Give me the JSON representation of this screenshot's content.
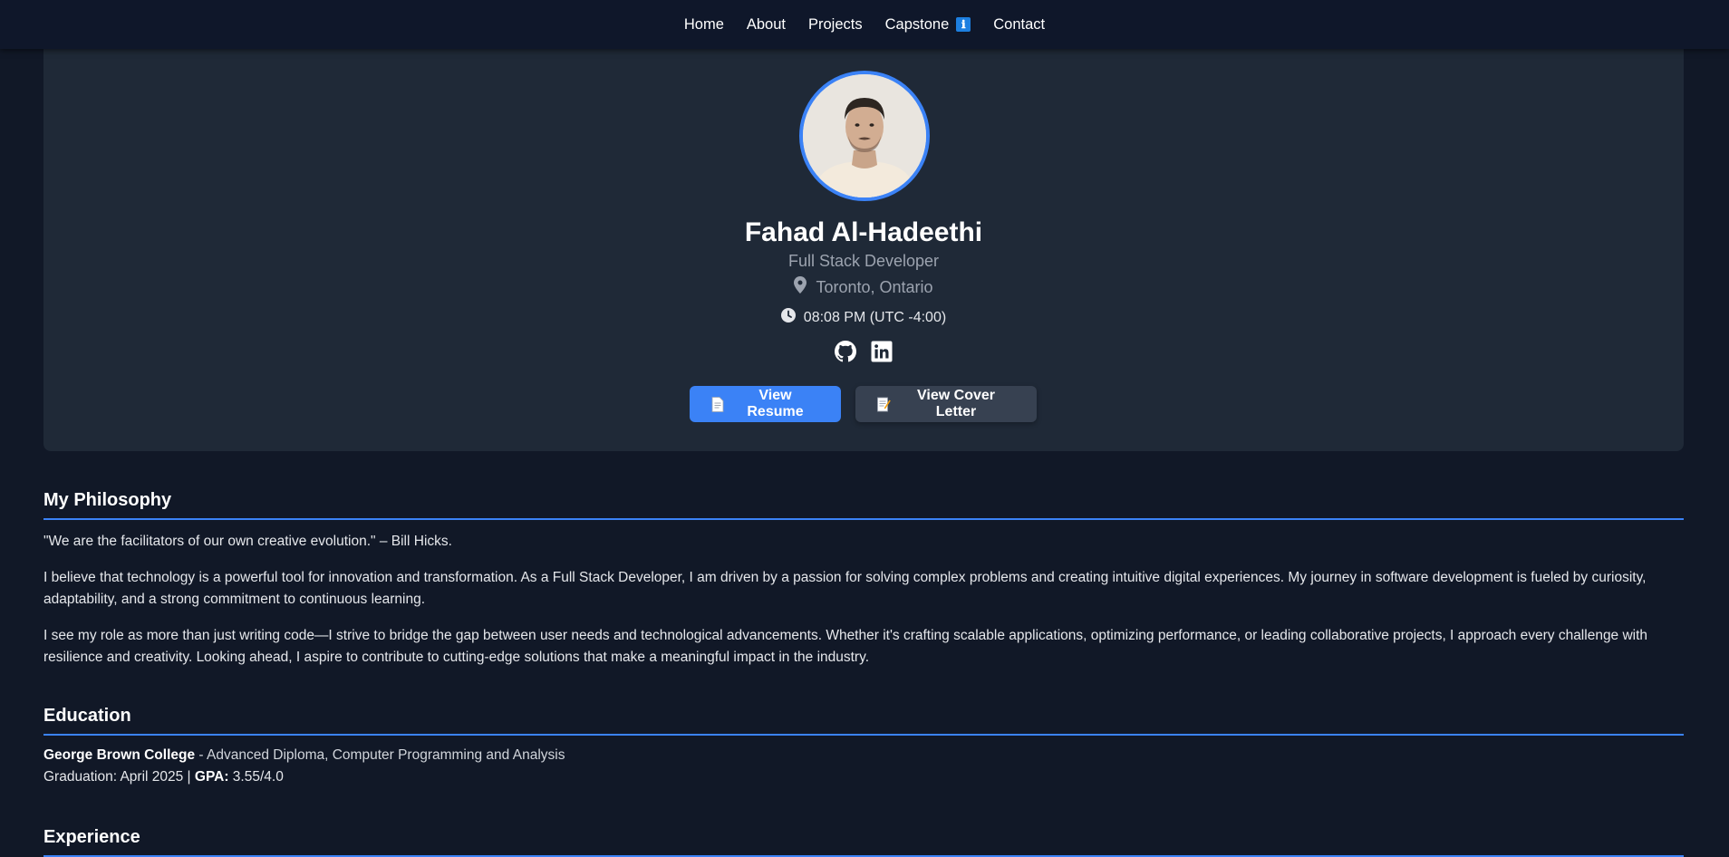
{
  "nav": {
    "items": [
      {
        "label": "Home"
      },
      {
        "label": "About"
      },
      {
        "label": "Projects"
      },
      {
        "label": "Capstone",
        "badge": "ℹ"
      },
      {
        "label": "Contact"
      }
    ]
  },
  "profile": {
    "name": "Fahad Al-Hadeethi",
    "role": "Full Stack Developer",
    "location": "Toronto, Ontario",
    "time": "08:08 PM (UTC -4:00)",
    "social_icons": [
      "github-icon",
      "linkedin-icon"
    ]
  },
  "actions": {
    "resume_label": "View Resume",
    "cover_letter_label": "View Cover Letter"
  },
  "philosophy": {
    "heading": "My Philosophy",
    "quote": "\"We are the facilitators of our own creative evolution.\" – Bill Hicks.",
    "paragraph1": "I believe that technology is a powerful tool for innovation and transformation. As a Full Stack Developer, I am driven by a passion for solving complex problems and creating intuitive digital experiences. My journey in software development is fueled by curiosity, adaptability, and a strong commitment to continuous learning.",
    "paragraph2": "I see my role as more than just writing code—I strive to bridge the gap between user needs and technological advancements. Whether it's crafting scalable applications, optimizing performance, or leading collaborative projects, I approach every challenge with resilience and creativity. Looking ahead, I aspire to contribute to cutting-edge solutions that make a meaningful impact in the industry."
  },
  "education": {
    "heading": "Education",
    "school": "George Brown College",
    "program": " - Advanced Diploma, Computer Programming and Analysis",
    "graduation_label": "Graduation: April 2025 | ",
    "gpa_label": "GPA:",
    "gpa_value": " 3.55/4.0"
  },
  "experience": {
    "heading": "Experience"
  },
  "colors": {
    "background": "#111827",
    "card": "#1f2937",
    "accent": "#3b82f6",
    "nav": "#0f172a"
  }
}
